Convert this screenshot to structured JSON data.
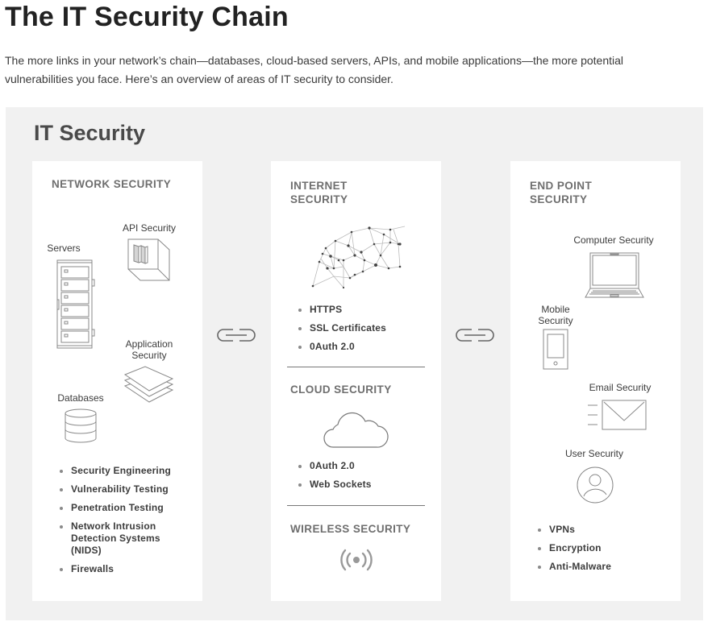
{
  "page": {
    "title": "The IT Security Chain",
    "intro": "The more links in your network’s chain—databases, cloud-based servers, APIs, and mobile applications—the more potential vulnerabilities you face. Here’s an overview of areas of IT security to consider."
  },
  "diagram": {
    "title": "IT Security",
    "connector_icon": "chain-link-icon",
    "panels": [
      {
        "heading": "NETWORK SECURITY",
        "illustrations": [
          {
            "label": "API Security",
            "icon": "api-cube-icon"
          },
          {
            "label": "Servers",
            "icon": "server-rack-icon"
          },
          {
            "label": "Application Security",
            "icon": "stacked-layers-icon"
          },
          {
            "label": "Databases",
            "icon": "database-icon"
          }
        ],
        "bullets": [
          "Security Engineering",
          "Vulnerability Testing",
          "Penetration Testing",
          "Network Intrusion Detection Systems (NIDS)",
          "Firewalls"
        ]
      },
      {
        "sections": [
          {
            "heading": "INTERNET SECURITY",
            "icon": "network-mesh-icon",
            "bullets": [
              "HTTPS",
              "SSL Certificates",
              "0Auth 2.0"
            ]
          },
          {
            "heading": "CLOUD SECURITY",
            "icon": "cloud-icon",
            "bullets": [
              "0Auth 2.0",
              "Web Sockets"
            ]
          },
          {
            "heading": "WIRELESS SECURITY",
            "icon": "wireless-signal-icon",
            "bullets": []
          }
        ]
      },
      {
        "heading": "END POINT SECURITY",
        "illustrations": [
          {
            "label": "Computer Security",
            "icon": "laptop-icon"
          },
          {
            "label": "Mobile Security",
            "icon": "mobile-phone-icon"
          },
          {
            "label": "Email Security",
            "icon": "envelope-icon"
          },
          {
            "label": "User Security",
            "icon": "user-circle-icon"
          }
        ],
        "bullets": [
          "VPNs",
          "Encryption",
          "Anti-Malware"
        ]
      }
    ]
  }
}
